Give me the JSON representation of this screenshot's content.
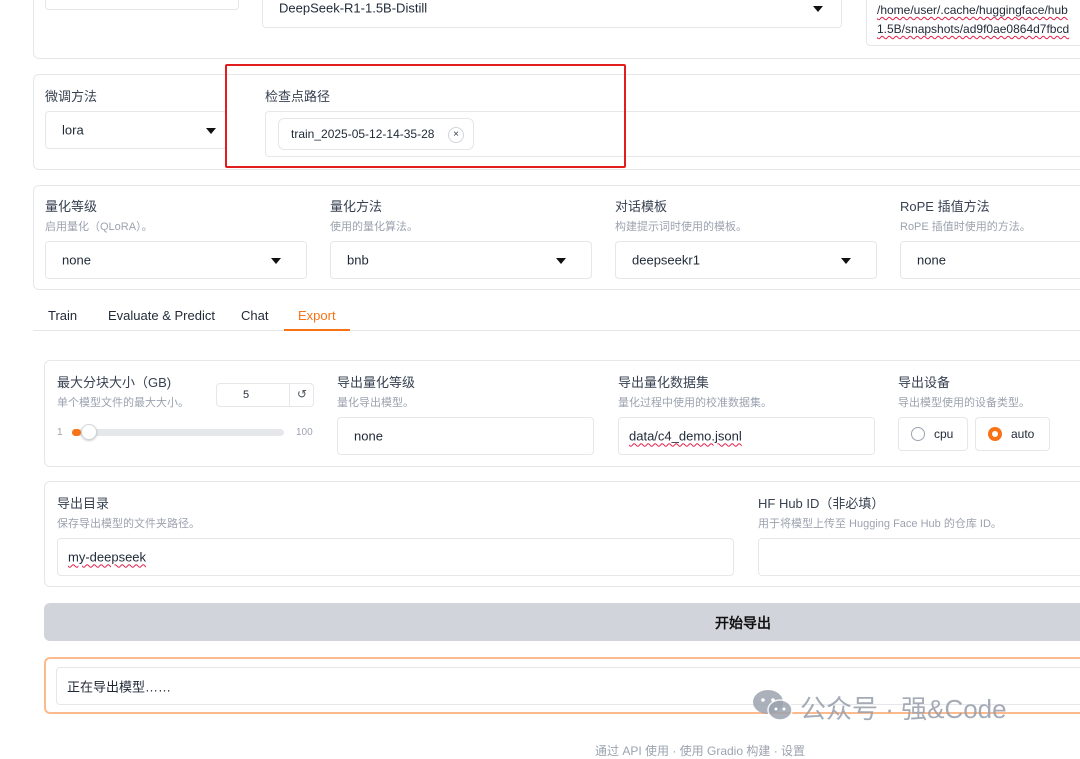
{
  "top": {
    "model_name": "DeepSeek-R1-1.5B-Distill",
    "model_path_line1": "/home/user/.cache/huggingface/hub",
    "model_path_line2": "1.5B/snapshots/ad9f0ae0864d7fbcd"
  },
  "finetune": {
    "method_label": "微调方法",
    "method_value": "lora",
    "checkpoint_label": "检查点路径",
    "checkpoint_chip": "train_2025-05-12-14-35-28",
    "chip_close": "×"
  },
  "quant": {
    "level_label": "量化等级",
    "level_desc": "启用量化（QLoRA）。",
    "level_value": "none",
    "method_label": "量化方法",
    "method_desc": "使用的量化算法。",
    "method_value": "bnb",
    "template_label": "对话模板",
    "template_desc": "构建提示词时使用的模板。",
    "template_value": "deepseekr1",
    "rope_label": "RoPE 插值方法",
    "rope_desc": "RoPE 插值时使用的方法。",
    "rope_value": "none"
  },
  "tabs": [
    {
      "label": "Train"
    },
    {
      "label": "Evaluate & Predict"
    },
    {
      "label": "Chat"
    },
    {
      "label": "Export"
    }
  ],
  "active_tab": "Export",
  "export": {
    "shard_label": "最大分块大小（GB)",
    "shard_desc": "单个模型文件的最大大小。",
    "shard_value": "5",
    "reset_icon": "↺",
    "slider_min": "1",
    "slider_max": "100",
    "slider_value": 5,
    "quant_bit_label": "导出量化等级",
    "quant_bit_desc": "量化导出模型。",
    "quant_bit_value": "none",
    "quant_dataset_label": "导出量化数据集",
    "quant_dataset_desc": "量化过程中使用的校准数据集。",
    "quant_dataset_value": "data/c4_demo.jsonl",
    "device_label": "导出设备",
    "device_desc": "导出模型使用的设备类型。",
    "device_cpu": "cpu",
    "device_auto": "auto",
    "device_selected": "auto",
    "dir_label": "导出目录",
    "dir_desc": "保存导出模型的文件夹路径。",
    "dir_value": "my-deepseek",
    "hub_label": "HF Hub ID（非必填）",
    "hub_desc": "用于将模型上传至 Hugging Face Hub 的仓库 ID。",
    "hub_value": "",
    "start_button": "开始导出",
    "status_text": "正在导出模型……"
  },
  "watermark": {
    "text": "公众号 · 强&Code"
  },
  "footer": {
    "text": "通过 API 使用  ·  使用 Gradio 构建  ·  设置"
  },
  "colors": {
    "accent": "#f97316",
    "highlight_box": "#e11d1d",
    "button_bg": "#d1d5db"
  }
}
